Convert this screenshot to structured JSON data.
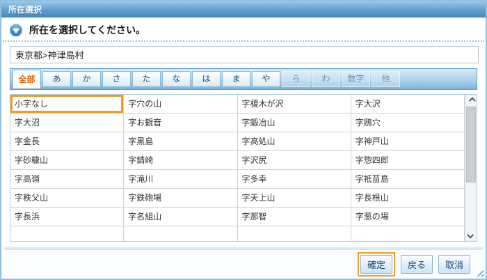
{
  "window": {
    "title": "所在選択"
  },
  "header": {
    "prompt": "所在を選択してください。",
    "icon": "down-arrow-circle-icon"
  },
  "path_field": {
    "value": "東京都>神津島村"
  },
  "tabs": [
    {
      "key": "all",
      "label": "全部",
      "state": "active"
    },
    {
      "key": "a",
      "label": "あ",
      "state": "enabled"
    },
    {
      "key": "ka",
      "label": "か",
      "state": "enabled"
    },
    {
      "key": "sa",
      "label": "さ",
      "state": "enabled"
    },
    {
      "key": "ta",
      "label": "た",
      "state": "enabled"
    },
    {
      "key": "na",
      "label": "な",
      "state": "enabled"
    },
    {
      "key": "ha",
      "label": "は",
      "state": "enabled"
    },
    {
      "key": "ma",
      "label": "ま",
      "state": "enabled"
    },
    {
      "key": "ya",
      "label": "や",
      "state": "enabled"
    },
    {
      "key": "ra",
      "label": "ら",
      "state": "disabled"
    },
    {
      "key": "wa",
      "label": "わ",
      "state": "disabled"
    },
    {
      "key": "digit",
      "label": "数字",
      "state": "disabled"
    },
    {
      "key": "other",
      "label": "他",
      "state": "disabled"
    }
  ],
  "grid": {
    "rows": [
      [
        "小字なし",
        "字穴の山",
        "字榎木が沢",
        "字大沢"
      ],
      [
        "字大沼",
        "字お観音",
        "字鍛冶山",
        "字鴎穴"
      ],
      [
        "字金長",
        "字黒島",
        "字高処山",
        "字神戸山"
      ],
      [
        "字砂糠山",
        "字錆崎",
        "字沢尻",
        "字惣四郎"
      ],
      [
        "字高嶺",
        "字滝川",
        "字多幸",
        "字祗苗島"
      ],
      [
        "字秩父山",
        "字鉄砲場",
        "字天上山",
        "字長根山"
      ],
      [
        "字長浜",
        "字名組山",
        "字那智",
        "字葱の場"
      ]
    ],
    "selected": "小字なし"
  },
  "scrollbar": {
    "up_icon": "chevron-up-icon",
    "down_icon": "chevron-down-icon"
  },
  "footer": {
    "confirm": "確定",
    "back": "戻る",
    "cancel": "取消"
  },
  "colors": {
    "accent_orange": "#f39c1f",
    "titlebar_top": "#9bc9e6",
    "titlebar_bottom": "#4689bf",
    "tab_active_text": "#e2660a",
    "button_text": "#17477b"
  }
}
